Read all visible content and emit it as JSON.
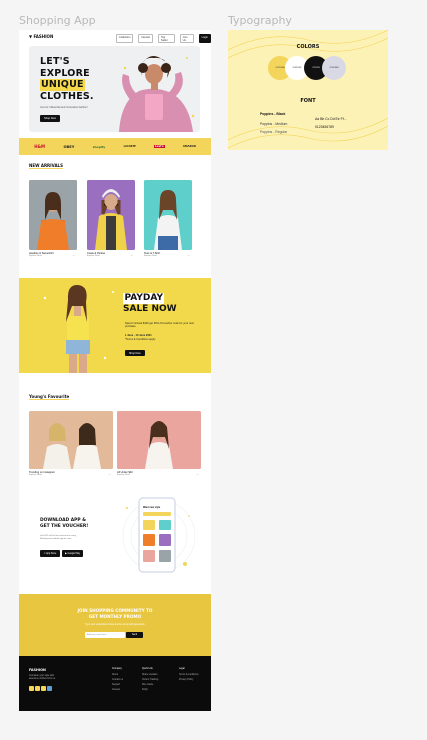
{
  "frames": {
    "app_label": "Shopping App",
    "typography_label": "Typography"
  },
  "colors": {
    "brand_yellow": "#F2D55A",
    "dark": "#0B0B0B",
    "light_gray": "#D9D9E6",
    "black": "#111111"
  },
  "nav": {
    "logo": "▼ FASHION",
    "links": [
      "Collection",
      "Interest",
      "Top Seller",
      "Join Us",
      "Login"
    ]
  },
  "hero": {
    "line1": "LET'S",
    "line2": "EXPLORE",
    "line3": "UNIQUE",
    "line4": "CLOTHES.",
    "subtitle": "Live for Influential and Innovative fashion!",
    "button": "Shop Now"
  },
  "brands": [
    "H&M",
    "OBEY",
    "shopify",
    "LACOSTE",
    "Levi's",
    "AMAZON"
  ],
  "new_arrivals": {
    "title": "NEW ARRIVALS",
    "items": [
      {
        "name": "Hoodies & Sweetshirt",
        "sub": "Explore Now!"
      },
      {
        "name": "Coats & Parkas",
        "sub": "Explore Now!"
      },
      {
        "name": "Tees & T-Shirt",
        "sub": "Explore Now!"
      }
    ]
  },
  "payday": {
    "line1": "PAYDAY",
    "line2": "SALE NOW",
    "text1": "Spend minimal $100 get 30% off voucher code for your next purchase",
    "text2": "1 June - 10 June 2021",
    "text3": "*Terms & Conditions apply",
    "button": "Shop Now"
  },
  "favourite": {
    "title": "Young's Favourite",
    "items": [
      {
        "name": "Trending on instagram",
        "sub": "Explore Now!"
      },
      {
        "name": "All Under $40",
        "sub": "Explore Now!"
      }
    ]
  },
  "download": {
    "line1": "DOWNLOAD APP &",
    "line2": "GET THE VOUCHER!",
    "text": "Get 30% off for first transaction using Rondovision mobile app for now.",
    "apple": "App Store",
    "google": "Google Play",
    "phone_heading": "Want new style"
  },
  "community": {
    "line1": "JOIN SHOPPING COMMUNITY TO",
    "line2": "GET MONTHLY PROMO",
    "text": "Type your email down below and be young wild generation",
    "placeholder": "Add your email here",
    "button": "Send"
  },
  "footer": {
    "logo": "FASHION",
    "text": "Complete your style with awesome clothes from us.",
    "col1_title": "Company",
    "col1": [
      "About",
      "Contact us",
      "Support",
      "Careers"
    ],
    "col2_title": "Quick Link",
    "col2": [
      "Share Location",
      "Orders Tracking",
      "Size Guide",
      "FAQs"
    ],
    "col3_title": "Legal",
    "col3": [
      "Terms & conditions",
      "Privacy Policy"
    ]
  },
  "typography": {
    "colors_title": "COLORS",
    "swatches": [
      "#F2D55A",
      "#FFFFFF",
      "#111111",
      "#D9D9E6"
    ],
    "font_title": "FONT",
    "fonts": [
      "Poppins - Black",
      "Poppins - Medium",
      "Poppins - Regular"
    ],
    "sample": "Aa Bb Cc Dd Ee Ff...",
    "digits": "0123456789"
  }
}
